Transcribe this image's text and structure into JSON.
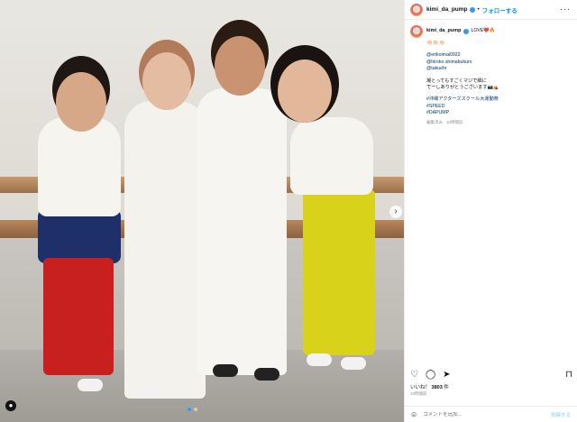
{
  "post": {
    "username": "kimi_da_pump",
    "follow_label": "フォローする",
    "separator": "•",
    "more_label": "···"
  },
  "caption": {
    "username": "kimi_da_pump",
    "first_line": "LOVE❤️🔥",
    "emoji_line": "👏🏻👏🏻👏🏻",
    "mentions": [
      "@erikoimai0922",
      "@hiroko.shimabukuro",
      "@takuehr"
    ],
    "message_lines": [
      "凝とっても​すごくマジで細に",
      "でーしありがとうございます📷⛺"
    ],
    "hashtags": [
      "#沖縄アクターズスクール大運動祭",
      "#SPEED",
      "#DAPUMP"
    ],
    "meta": "編集済み · 10時間前"
  },
  "actions": {
    "like_icon": "heart-icon",
    "comment_icon": "comment-icon",
    "share_icon": "share-icon",
    "save_icon": "bookmark-icon"
  },
  "likes": {
    "label": "いいね！",
    "count": "3803",
    "suffix": "件"
  },
  "date": "10時間前",
  "comment": {
    "placeholder": "コメントを追加...",
    "post_label": "投稿する"
  },
  "colors": {
    "link_blue": "#0095f6",
    "hashtag": "#00376b",
    "muted": "#8e8e8e"
  }
}
